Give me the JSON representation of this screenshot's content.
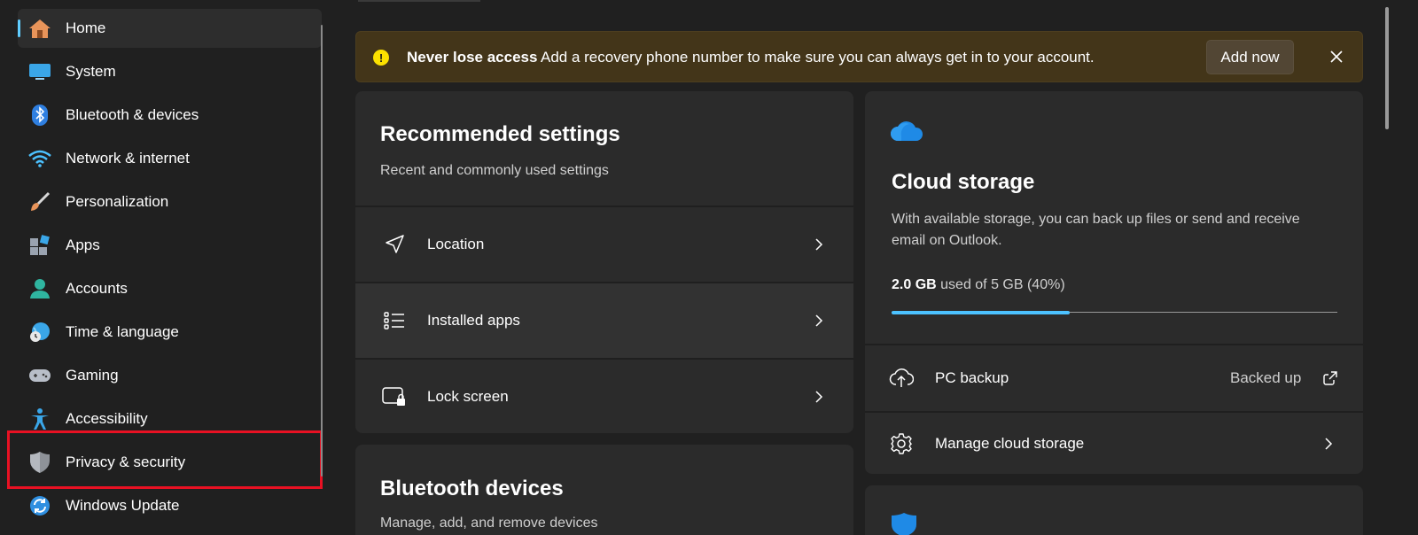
{
  "sidebar": {
    "items": [
      {
        "label": "Home",
        "icon": "home-icon"
      },
      {
        "label": "System",
        "icon": "system-icon"
      },
      {
        "label": "Bluetooth & devices",
        "icon": "bluetooth-icon"
      },
      {
        "label": "Network & internet",
        "icon": "wifi-icon"
      },
      {
        "label": "Personalization",
        "icon": "brush-icon"
      },
      {
        "label": "Apps",
        "icon": "apps-icon"
      },
      {
        "label": "Accounts",
        "icon": "accounts-icon"
      },
      {
        "label": "Time & language",
        "icon": "globe-clock-icon"
      },
      {
        "label": "Gaming",
        "icon": "gamepad-icon"
      },
      {
        "label": "Accessibility",
        "icon": "accessibility-icon"
      },
      {
        "label": "Privacy & security",
        "icon": "shield-icon"
      },
      {
        "label": "Windows Update",
        "icon": "update-icon"
      }
    ],
    "active_index": 0,
    "highlighted_index": 10
  },
  "banner": {
    "title": "Never lose access",
    "message": "Add a recovery phone number to make sure you can always get in to your account.",
    "button": "Add now"
  },
  "recommended": {
    "title": "Recommended settings",
    "subtitle": "Recent and commonly used settings",
    "rows": [
      {
        "label": "Location",
        "icon": "location-arrow-icon"
      },
      {
        "label": "Installed apps",
        "icon": "list-icon"
      },
      {
        "label": "Lock screen",
        "icon": "lock-screen-icon"
      }
    ]
  },
  "bluetooth": {
    "title": "Bluetooth devices",
    "subtitle": "Manage, add, and remove devices"
  },
  "cloud": {
    "title": "Cloud storage",
    "description_line1": "With available storage, you can back up files or send and receive",
    "description_line2": "email on Outlook.",
    "used_amount": "2.0 GB",
    "used_rest": "used of 5 GB (40%)",
    "used_fraction": 0.4,
    "backup_label": "PC backup",
    "backup_status": "Backed up",
    "manage_label": "Manage cloud storage"
  },
  "colors": {
    "accent": "#60cdff",
    "banner_bg": "#433519",
    "storage_bar": "#4cc2ff",
    "highlight": "#e81123"
  }
}
